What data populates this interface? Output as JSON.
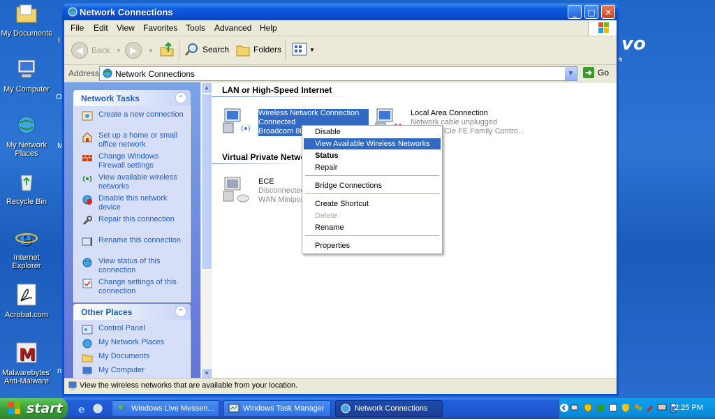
{
  "desktop": {
    "icons": [
      {
        "label": "My Documents"
      },
      {
        "label": "My Computer"
      },
      {
        "label": "My Network Places"
      },
      {
        "label": "Recycle Bin"
      },
      {
        "label": "Internet Explorer"
      },
      {
        "label": "Acrobat.com"
      },
      {
        "label": "Malwarebytes' Anti-Malware"
      }
    ],
    "partial_labels": [
      "I",
      "O",
      "M",
      "n"
    ],
    "brand": "vo",
    "brand_sub": "n"
  },
  "window": {
    "title": "Network Connections",
    "controls": {
      "minimize": "_",
      "maximize": "□",
      "close": "✕"
    },
    "menu": [
      "File",
      "Edit",
      "View",
      "Favorites",
      "Tools",
      "Advanced",
      "Help"
    ],
    "toolbar": {
      "back": "Back",
      "search": "Search",
      "folders": "Folders"
    },
    "address": {
      "label": "Address",
      "value": "Network Connections",
      "go": "Go"
    },
    "network_tasks": {
      "header": "Network Tasks",
      "items": [
        {
          "label": "Create a new connection",
          "icon": "new-connection-icon"
        },
        {
          "label": "Set up a home or small office network",
          "icon": "home-network-icon"
        },
        {
          "label": "Change Windows Firewall settings",
          "icon": "firewall-icon"
        },
        {
          "label": "View available wireless networks",
          "icon": "wireless-icon"
        },
        {
          "label": "Disable this network device",
          "icon": "disable-icon"
        },
        {
          "label": "Repair this connection",
          "icon": "repair-icon"
        },
        {
          "label": "Rename this connection",
          "icon": "rename-icon"
        },
        {
          "label": "View status of this connection",
          "icon": "status-icon"
        },
        {
          "label": "Change settings of this connection",
          "icon": "settings-icon"
        }
      ]
    },
    "other_places": {
      "header": "Other Places",
      "items": [
        {
          "label": "Control Panel"
        },
        {
          "label": "My Network Places"
        },
        {
          "label": "My Documents"
        },
        {
          "label": "My Computer"
        }
      ]
    },
    "groups": [
      {
        "header": "LAN or High-Speed Internet",
        "connections": [
          {
            "name": "Wireless Network Connection",
            "status": "Connected",
            "device": "Broadcom 80",
            "selected": true
          },
          {
            "name": "Local Area Connection",
            "status": "Network cable unplugged",
            "device": "CIe FE Family Contro..."
          }
        ]
      },
      {
        "header": "Virtual Private Netwo",
        "connections": [
          {
            "name": "ECE",
            "status": "Disconnected",
            "device": "WAN Minipor"
          }
        ]
      }
    ],
    "context_menu": {
      "items": [
        {
          "label": "Disable"
        },
        {
          "label": "View Available Wireless Networks",
          "highlighted": true
        },
        {
          "label": "Status",
          "bold": true
        },
        {
          "label": "Repair"
        },
        {
          "label": "Bridge Connections"
        },
        {
          "label": "Create Shortcut"
        },
        {
          "label": "Delete",
          "disabled": true
        },
        {
          "label": "Rename"
        },
        {
          "label": "Properties"
        }
      ]
    },
    "status_bar": "View the wireless networks that are available from your location."
  },
  "taskbar": {
    "start": "start",
    "tasks": [
      {
        "label": "Windows Live Messen...",
        "icon": "messenger-icon"
      },
      {
        "label": "Windows Task Manager",
        "icon": "task-manager-icon"
      },
      {
        "label": "Network Connections",
        "icon": "network-connections-icon",
        "active": true
      }
    ],
    "clock": "2:25 PM"
  },
  "colors": {
    "selection": "#316ac5",
    "link": "#215dc6",
    "titlebar": "#0a4fd0",
    "start": "#3d9f3a"
  }
}
